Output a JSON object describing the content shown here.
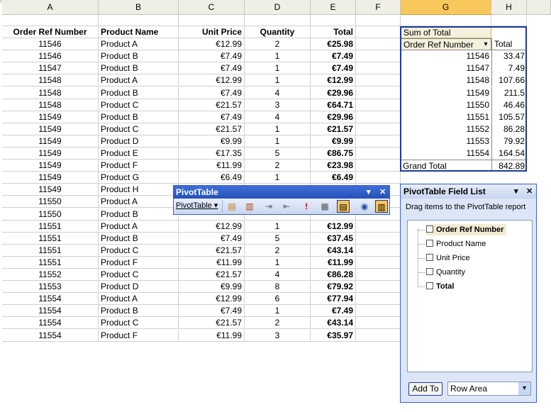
{
  "columns": [
    "A",
    "B",
    "C",
    "D",
    "E",
    "F",
    "G",
    "H"
  ],
  "selected_column": "G",
  "table": {
    "headers": [
      "Order Ref Number",
      "Product Name",
      "Unit Price",
      "Quantity",
      "Total"
    ],
    "rows": [
      [
        "11546",
        "Product A",
        "€12.99",
        "2",
        "€25.98"
      ],
      [
        "11546",
        "Product B",
        "€7.49",
        "1",
        "€7.49"
      ],
      [
        "11547",
        "Product B",
        "€7.49",
        "1",
        "€7.49"
      ],
      [
        "11548",
        "Product A",
        "€12.99",
        "1",
        "€12.99"
      ],
      [
        "11548",
        "Product B",
        "€7.49",
        "4",
        "€29.96"
      ],
      [
        "11548",
        "Product C",
        "€21.57",
        "3",
        "€64.71"
      ],
      [
        "11549",
        "Product B",
        "€7.49",
        "4",
        "€29.96"
      ],
      [
        "11549",
        "Product C",
        "€21.57",
        "1",
        "€21.57"
      ],
      [
        "11549",
        "Product D",
        "€9.99",
        "1",
        "€9.99"
      ],
      [
        "11549",
        "Product E",
        "€17.35",
        "5",
        "€86.75"
      ],
      [
        "11549",
        "Product F",
        "€11.99",
        "2",
        "€23.98"
      ],
      [
        "11549",
        "Product G",
        "€6.49",
        "1",
        "€6.49"
      ],
      [
        "11549",
        "Product H",
        "",
        "",
        ""
      ],
      [
        "11550",
        "Product A",
        "",
        "",
        ""
      ],
      [
        "11550",
        "Product B",
        "",
        "",
        ""
      ],
      [
        "11551",
        "Product A",
        "€12.99",
        "1",
        "€12.99"
      ],
      [
        "11551",
        "Product B",
        "€7.49",
        "5",
        "€37.45"
      ],
      [
        "11551",
        "Product C",
        "€21.57",
        "2",
        "€43.14"
      ],
      [
        "11551",
        "Product F",
        "€11.99",
        "1",
        "€11.99"
      ],
      [
        "11552",
        "Product C",
        "€21.57",
        "4",
        "€86.28"
      ],
      [
        "11553",
        "Product D",
        "€9.99",
        "8",
        "€79.92"
      ],
      [
        "11554",
        "Product A",
        "€12.99",
        "6",
        "€77.94"
      ],
      [
        "11554",
        "Product B",
        "€7.49",
        "1",
        "€7.49"
      ],
      [
        "11554",
        "Product C",
        "€21.57",
        "2",
        "€43.14"
      ],
      [
        "11554",
        "Product F",
        "€11.99",
        "3",
        "€35.97"
      ]
    ]
  },
  "pivot": {
    "data_label": "Sum of Total",
    "row_field": "Order Ref Number",
    "value_header": "Total",
    "rows": [
      [
        "11546",
        "33.47"
      ],
      [
        "11547",
        "7.49"
      ],
      [
        "11548",
        "107.66"
      ],
      [
        "11549",
        "211.5"
      ],
      [
        "11550",
        "46.46"
      ],
      [
        "11551",
        "105.57"
      ],
      [
        "11552",
        "86.28"
      ],
      [
        "11553",
        "79.92"
      ],
      [
        "11554",
        "164.54"
      ]
    ],
    "grand_total_label": "Grand Total",
    "grand_total_value": "842.89"
  },
  "pivot_toolbar": {
    "title": "PivotTable",
    "menu_label": "PivotTable ▾",
    "dropdown": "▾",
    "close": "✕"
  },
  "field_list": {
    "title": "PivotTable Field List",
    "hint": "Drag items to the PivotTable report",
    "fields": [
      "Order Ref Number",
      "Product Name",
      "Unit Price",
      "Quantity",
      "Total"
    ],
    "add_to_label": "Add To",
    "area_value": "Row Area",
    "dropdown": "▾",
    "close": "✕"
  }
}
